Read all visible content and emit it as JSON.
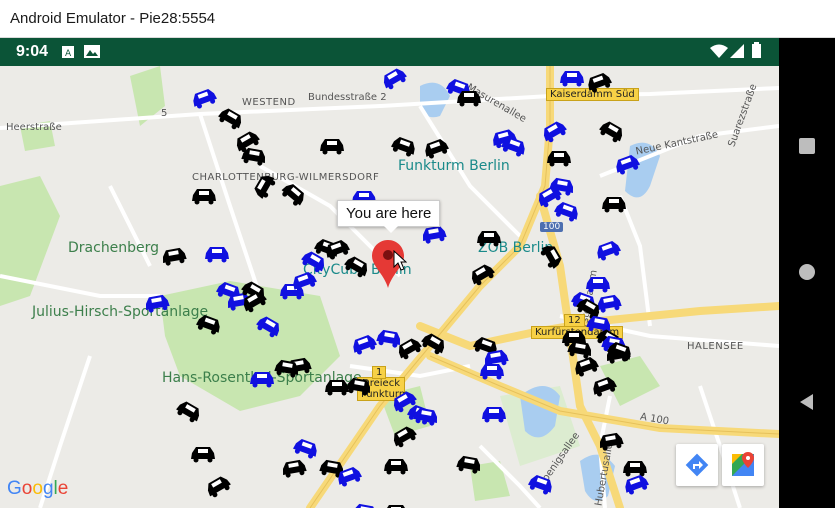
{
  "window": {
    "title": "Android Emulator - Pie28:5554"
  },
  "status_bar": {
    "time": "9:04"
  },
  "map": {
    "marker_tooltip": "You are here",
    "road_labels": [
      "Bundesstraße 2",
      "Heerstraße",
      "Masurenallee",
      "Neue Kantstraße",
      "Suarezstraße",
      "Kurfürstendamm",
      "Koenigsallee",
      "Hubertusallee",
      "A 100",
      "5"
    ],
    "district_labels": [
      "WESTEND",
      "CHARLOTTENBURG-WILMERSDORF",
      "HALENSEE"
    ],
    "green_labels": [
      "Drachenberg",
      "Julius-Hirsch-Sportanlage",
      "Hans-Rosenthal-Sportanlage"
    ],
    "poi_labels": [
      "Funkturm Berlin",
      "CityCube Berlin",
      "ZOB Berlin"
    ],
    "shields": [
      "Kaiserdamm Süd",
      "Kurfürstendamm",
      "Dreieck Funkturm",
      "12",
      "1"
    ],
    "route_shields": [
      "100"
    ],
    "attribution": "Google",
    "colors": {
      "taxi_blue": "#1010e0",
      "taxi_black": "#000000",
      "marker": "#e53935",
      "status_bar": "#0b5437",
      "park": "#c8e6b0",
      "water": "#a9cdf0",
      "highway": "#f7d979"
    }
  },
  "buttons": {
    "directions": "directions-icon",
    "open_in_maps": "google-maps-icon"
  },
  "nav_bar": {
    "recents": "square-icon",
    "home": "circle-icon",
    "back": "triangle-icon"
  }
}
